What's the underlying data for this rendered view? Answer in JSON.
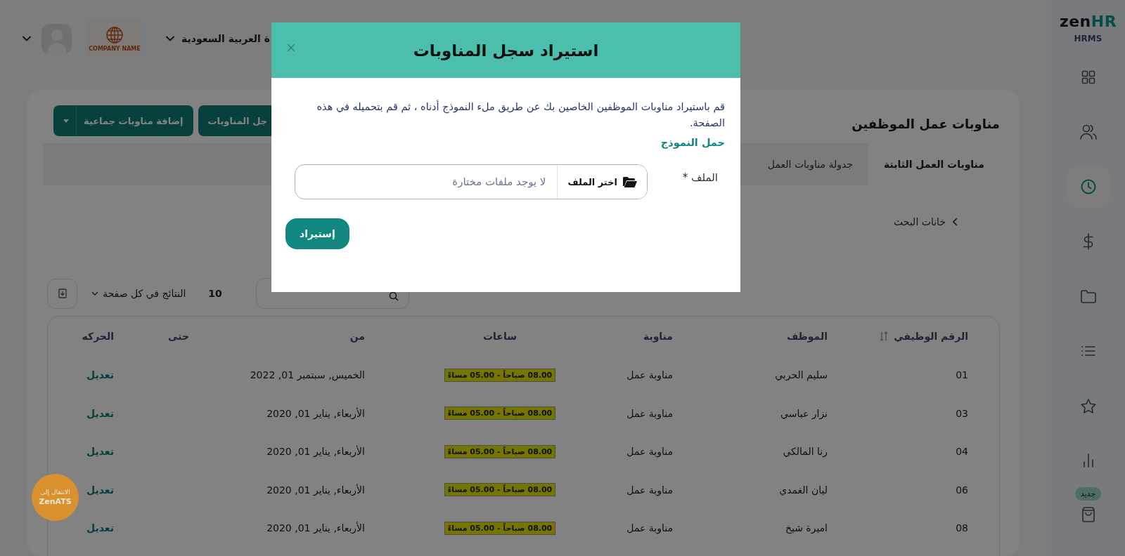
{
  "header": {
    "country": "ة العربية السعودية",
    "company_logo_text": "COMPANY NAME"
  },
  "sidebar": {
    "logo_main": "zen",
    "logo_accent": "HR",
    "subtitle": "HRMS",
    "items": [
      {
        "kind": "grid",
        "selected": false
      },
      {
        "kind": "users",
        "selected": false
      },
      {
        "kind": "clock",
        "selected": true
      },
      {
        "kind": "dollar",
        "selected": false
      },
      {
        "kind": "folder",
        "selected": false
      },
      {
        "kind": "list",
        "selected": false
      },
      {
        "kind": "star",
        "selected": false
      },
      {
        "kind": "chart",
        "selected": false
      },
      {
        "kind": "bag",
        "selected": false,
        "badge": "جديد"
      }
    ]
  },
  "page": {
    "title": "مناوبات عمل الموظفين",
    "buttons": [
      {
        "kind": "plain",
        "label": "جل المناوبات"
      },
      {
        "kind": "split",
        "label": "إضافة مناوبات جماعية"
      }
    ],
    "tabs": [
      {
        "label": "مناوبات العمل الثابتة",
        "selected": true
      },
      {
        "label": "جدولة مناوبات العمل",
        "selected": false
      }
    ],
    "filters_toggle": "خانات البحث",
    "page_size": "10",
    "page_size_label": "النتائج في كل صفحة"
  },
  "table": {
    "columns": [
      "الرقم الوظيفي",
      "الموظف",
      "مناوبة",
      "ساعات",
      "من",
      "حتى",
      "الحركه"
    ],
    "rows": [
      {
        "id": "01",
        "employee": "سليم الحربي",
        "shift": "مناوبة عمل",
        "hours": "08.00 صباحاً - 05.00 مساءً",
        "from": "الخميس, سبتمبر 01, 2022",
        "action": "تعديل"
      },
      {
        "id": "03",
        "employee": "نزار عباسي",
        "shift": "مناوبة عمل",
        "hours": "08.00 صباحاً - 05.00 مساءً",
        "from": "الأربعاء, يناير 01, 2020",
        "action": "تعديل"
      },
      {
        "id": "04",
        "employee": "رنا المالكي",
        "shift": "مناوبة عمل",
        "hours": "08.00 صباحاً - 05.00 مساءً",
        "from": "الأربعاء, يناير 01, 2020",
        "action": "تعديل"
      },
      {
        "id": "06",
        "employee": "ليان الغمدي",
        "shift": "مناوبة عمل",
        "hours": "08.00 صباحاً - 05.00 مساءً",
        "from": "الأربعاء, يناير 01, 2020",
        "action": "تعديل"
      },
      {
        "id": "08",
        "employee": "اميرة شيخ",
        "shift": "مناوبة عمل",
        "hours": "08.00 صباحاً - 05.00 مساءً",
        "from": "الأربعاء, يناير 01, 2020",
        "action": "تعديل"
      }
    ]
  },
  "ats_button": {
    "line1": "الانتقال إلى",
    "line2": "ZenATS"
  },
  "modal": {
    "title": "استيراد سجل المناوبات",
    "description": "قم باستيراد مناوبات الموظفين الخاصين بك عن طريق ملء النموذج أدناه ، ثم قم بتحميله في هذه الصفحة.",
    "template_link": "حمل النموذج",
    "file_label": "الملف",
    "required_mark": "*",
    "choose_button": "اختر الملف",
    "file_placeholder": "لا يوجد ملفات مختارة",
    "submit": "إستيراد"
  }
}
